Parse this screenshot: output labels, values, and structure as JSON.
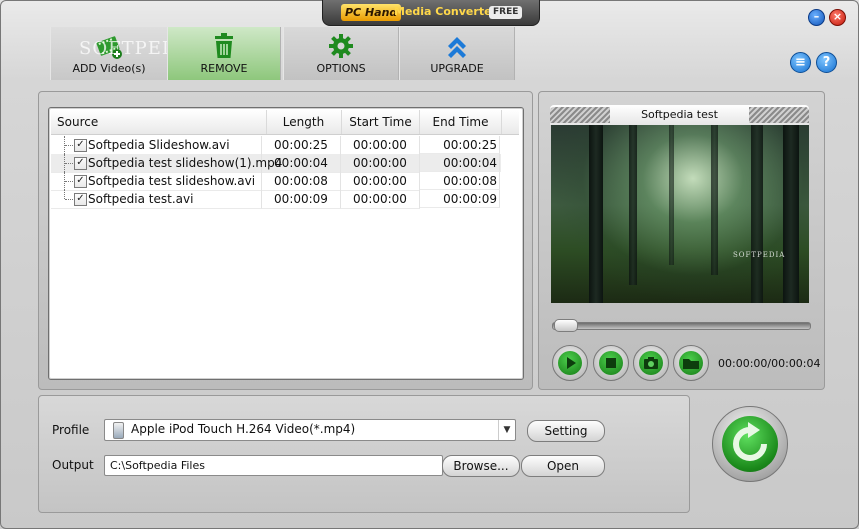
{
  "window": {
    "logo_text": "PC Hand",
    "title": "Media Converter",
    "badge": "FREE"
  },
  "toolbar": {
    "add_label": "ADD Video(s)",
    "remove_label": "REMOVE",
    "options_label": "OPTIONS",
    "upgrade_label": "UPGRADE",
    "watermark": "SOFTPEDIA"
  },
  "file_list": {
    "columns": [
      "Source",
      "Length",
      "Start Time",
      "End Time"
    ],
    "rows": [
      {
        "name": "Softpedia Slideshow.avi",
        "length": "00:00:25",
        "start": "00:00:00",
        "end": "00:00:25",
        "checked": true
      },
      {
        "name": "Softpedia test slideshow(1).mp4",
        "length": "00:00:04",
        "start": "00:00:00",
        "end": "00:00:04",
        "checked": true
      },
      {
        "name": "Softpedia test slideshow.avi",
        "length": "00:00:08",
        "start": "00:00:00",
        "end": "00:00:08",
        "checked": true
      },
      {
        "name": "Softpedia test.avi",
        "length": "00:00:09",
        "start": "00:00:00",
        "end": "00:00:09",
        "checked": true
      }
    ]
  },
  "preview": {
    "title": "Softpedia test",
    "video_watermark": "SOFTPEDIA",
    "time": "00:00:00/00:00:04",
    "seek_position": 0.0
  },
  "settings": {
    "profile_label": "Profile",
    "profile_value": "Apple iPod Touch H.264 Video(*.mp4)",
    "setting_button": "Setting",
    "output_label": "Output",
    "output_value": "C:\\Softpedia Files",
    "browse_button": "Browse...",
    "open_button": "Open"
  },
  "colors": {
    "accent_green": "#1a881a",
    "accent_blue": "#1670d0",
    "title_gold": "#ffd84a"
  }
}
